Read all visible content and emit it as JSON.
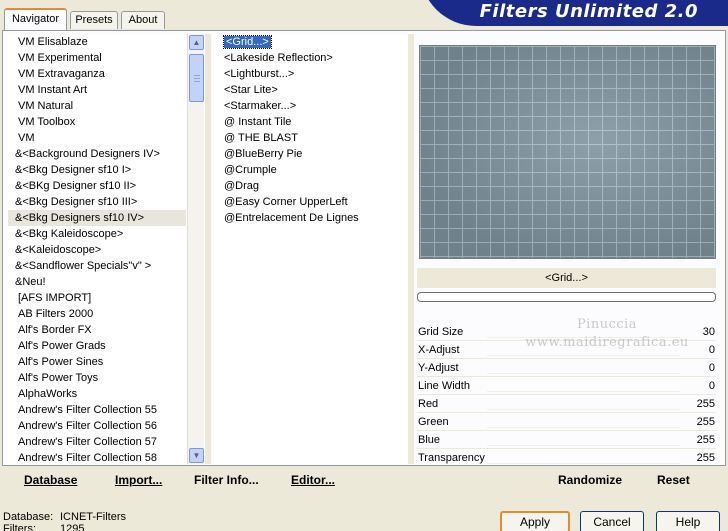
{
  "tabs": [
    {
      "label": "Navigator",
      "active": true
    },
    {
      "label": "Presets",
      "active": false
    },
    {
      "label": "About",
      "active": false
    }
  ],
  "app_title": "Filters Unlimited 2.0",
  "categories": [
    {
      "label": "VM Elisablaze"
    },
    {
      "label": "VM Experimental"
    },
    {
      "label": "VM Extravaganza"
    },
    {
      "label": "VM Instant Art"
    },
    {
      "label": "VM Natural"
    },
    {
      "label": "VM Toolbox"
    },
    {
      "label": "VM"
    },
    {
      "label": "&<Background Designers IV>"
    },
    {
      "label": "&<Bkg Designer sf10 I>"
    },
    {
      "label": "&<BKg Designer sf10 II>"
    },
    {
      "label": "&<Bkg Designer sf10 III>"
    },
    {
      "label": "&<Bkg Designers sf10 IV>",
      "selected": true
    },
    {
      "label": "&<Bkg Kaleidoscope>"
    },
    {
      "label": "&<Kaleidoscope>"
    },
    {
      "label": "&<Sandflower Specials\"v\" >"
    },
    {
      "label": "&Neu!"
    },
    {
      "label": "[AFS IMPORT]"
    },
    {
      "label": "AB Filters 2000"
    },
    {
      "label": "Alf's Border FX"
    },
    {
      "label": "Alf's Power Grads"
    },
    {
      "label": "Alf's Power Sines"
    },
    {
      "label": "Alf's Power Toys"
    },
    {
      "label": "AlphaWorks"
    },
    {
      "label": "Andrew's Filter Collection 55"
    },
    {
      "label": "Andrew's Filter Collection 56"
    },
    {
      "label": "Andrew's Filter Collection 57"
    },
    {
      "label": "Andrew's Filter Collection 58"
    }
  ],
  "filters": [
    {
      "label": "<Grid...>",
      "selected": true
    },
    {
      "label": "<Lakeside Reflection>"
    },
    {
      "label": "<Lightburst...>"
    },
    {
      "label": "<Star Lite>"
    },
    {
      "label": "<Starmaker...>"
    },
    {
      "label": "@ Instant Tile"
    },
    {
      "label": "@ THE BLAST"
    },
    {
      "label": "@BlueBerry Pie"
    },
    {
      "label": "@Crumple"
    },
    {
      "label": "@Drag"
    },
    {
      "label": "@Easy Corner UpperLeft"
    },
    {
      "label": "@Entrelacement De Lignes"
    }
  ],
  "selected_filter_name": "<Grid...>",
  "progress_fraction": 0,
  "params": [
    {
      "name": "Grid Size",
      "value": "30"
    },
    {
      "name": "X-Adjust",
      "value": "0"
    },
    {
      "name": "Y-Adjust",
      "value": "0"
    },
    {
      "name": "Line Width",
      "value": "0"
    },
    {
      "name": "Red",
      "value": "255"
    },
    {
      "name": "Green",
      "value": "255"
    },
    {
      "name": "Blue",
      "value": "255"
    },
    {
      "name": "Transparency",
      "value": "255"
    }
  ],
  "watermark": {
    "line1": "Pinuccia",
    "line2": "www.maidiregrafica.eu"
  },
  "left_actions": {
    "database": "Database",
    "import": "Import...",
    "filter_info": "Filter Info...",
    "editor": "Editor..."
  },
  "right_actions": {
    "randomize": "Randomize",
    "reset": "Reset"
  },
  "status": {
    "database_label": "Database:",
    "database_value": "ICNET-Filters",
    "filters_label": "Filters:",
    "filters_value": "1295"
  },
  "buttons": {
    "apply": "Apply",
    "cancel": "Cancel",
    "help": "Help"
  },
  "colors": {
    "banner": "#1a2a8a",
    "selection": "#316ac5",
    "tab_accent": "#e68b2c",
    "preview_bg": "#7e929c"
  }
}
